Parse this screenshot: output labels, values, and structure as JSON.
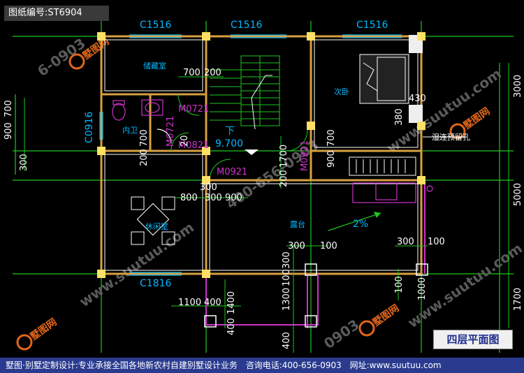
{
  "header": {
    "drawing_no": "图纸编号:ST6904"
  },
  "floor_title": "四层平面图",
  "footer": {
    "company": "墅图·别墅定制设计:专业承接全国各地新农村自建别墅设计业务",
    "phone": "咨询电话:400-656-0903",
    "site": "网址:www.suutuu.com"
  },
  "windows": {
    "w1": "C1516",
    "w2": "C1516",
    "w3": "C1516",
    "w4": "C0916",
    "w5": "C1816"
  },
  "doors": {
    "d1": "M0721",
    "d2": "M0721",
    "d3": "M0821",
    "d4": "M0921",
    "d5": "M0921"
  },
  "rooms": {
    "storage": "储藏室",
    "bath": "内卫",
    "bedroom": "次卧",
    "leisure": "休闲室",
    "terrace": "露台",
    "ac_hole": "湿连预留孔"
  },
  "stair": {
    "direction": "下",
    "elevation": "9.700"
  },
  "slope": "2%",
  "dims": {
    "top_700": "700",
    "top_200": "200",
    "left_900": "900",
    "left_700": "700",
    "left_300": "300",
    "mid_700": "700",
    "mid_200": "200",
    "small_20": "20",
    "d_800": "800",
    "d_300": "300",
    "d_300b": "300",
    "d_900": "900",
    "v_1700": "1700",
    "v_200": "200",
    "v_900": "900",
    "v_700": "700",
    "r_430": "430",
    "r_380": "380",
    "t_300a": "300",
    "t_100a": "100",
    "t_300b": "300",
    "t_100b": "100",
    "t_1300": "1300",
    "t_100c": "100",
    "t_300c": "300",
    "b_1100": "1100",
    "b_400": "400",
    "b_1400": "1400",
    "b_400b": "400",
    "b_400c": "400",
    "b_100": "100",
    "b_1000": "1000",
    "rr_3000": "3000",
    "rr_5000": "5000",
    "rr_1700": "1700"
  },
  "watermarks": {
    "logo": "墅图网",
    "phone_frag1": "6-0903",
    "phone_frag2": "400-656-0903",
    "phone_frag3": "0903",
    "url": "www.suutuu.com"
  }
}
